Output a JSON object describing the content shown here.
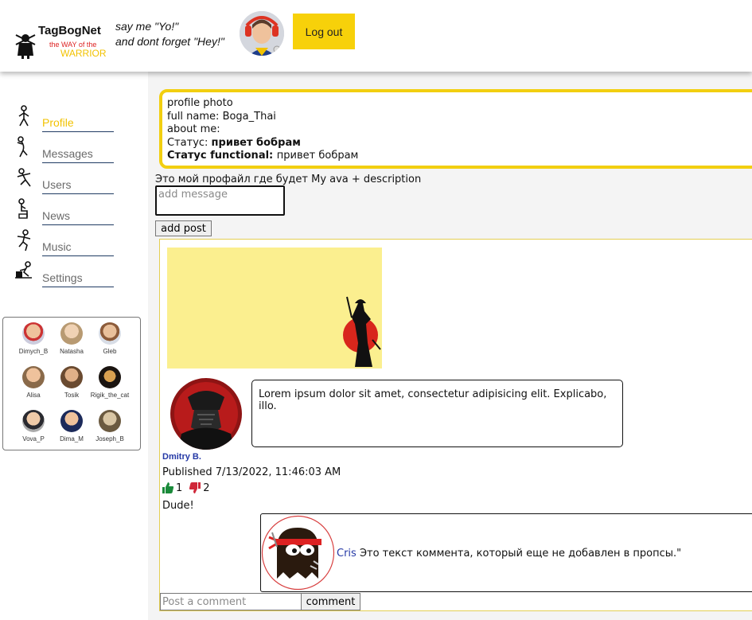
{
  "header": {
    "brand": "TagBogNet",
    "tagline_top": "the WAY of the",
    "tagline_bottom": "WARRIOR",
    "slogan_line1": "say me \"Yo!\"",
    "slogan_line2": "and dont forget \"Hey!\"",
    "logout_label": "Log out",
    "logo_icon": "warrior-logo-icon",
    "colors": {
      "accent": "#f7d10a",
      "tagline_red": "#d22222",
      "tagline_yellow": "#f2c200"
    }
  },
  "sidebar": {
    "items": [
      {
        "label": "Profile",
        "icon": "stickman-standing-icon",
        "active": true
      },
      {
        "label": "Messages",
        "icon": "stickman-leaning-icon",
        "active": false
      },
      {
        "label": "Users",
        "icon": "stickman-running-icon",
        "active": false
      },
      {
        "label": "News",
        "icon": "stickman-sitting-icon",
        "active": false
      },
      {
        "label": "Music",
        "icon": "stickman-jumping-icon",
        "active": false
      },
      {
        "label": "Settings",
        "icon": "stickman-working-icon",
        "active": false
      }
    ],
    "active_color": "#f2c200"
  },
  "friends": [
    {
      "name": "Dimych_B"
    },
    {
      "name": "Natasha"
    },
    {
      "name": "Gleb"
    },
    {
      "name": "Alisa"
    },
    {
      "name": "Tosik"
    },
    {
      "name": "Rigik_the_cat"
    },
    {
      "name": "Vova_P"
    },
    {
      "name": "Dima_M"
    },
    {
      "name": "Joseph_B"
    }
  ],
  "profile": {
    "photo_alt": "profile photo",
    "full_name_label": "full name: ",
    "full_name": "Boga_Thai",
    "about_label": "about me:",
    "status_label": "Статус: ",
    "status": "привет бобрам",
    "status_functional_label": "Статус functional: ",
    "status_functional": "привет бобрам",
    "border_color": "#f2cf10"
  },
  "description": "Это мой профайл где будет My ava + description",
  "new_post": {
    "placeholder": "add message",
    "button_label": "add post"
  },
  "post": {
    "text": "Lorem ipsum dolor sit amet, consectetur adipisicing elit. Explicabo, illo.",
    "author": "Dmitry B.",
    "published": "Published 7/13/2022, 11:46:03 AM",
    "likes": "1",
    "dislikes": "2",
    "body": "Dude!",
    "comment": {
      "author": "Cris",
      "text": " Это текст коммента, который еще не добавлен в пропсы.\""
    },
    "comment_input_placeholder": "Post a comment",
    "comment_button_label": "comment"
  }
}
